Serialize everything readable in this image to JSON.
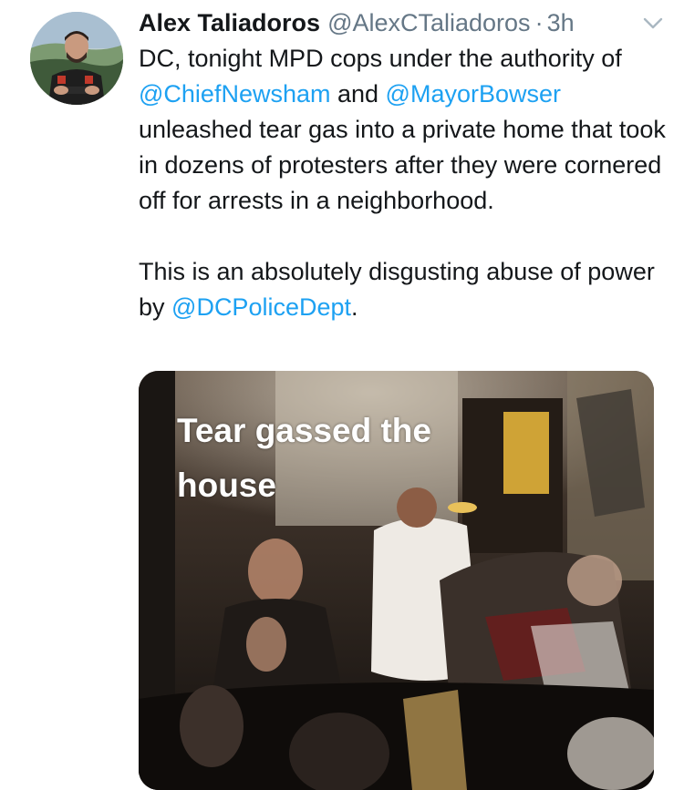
{
  "tweet": {
    "author": {
      "display_name": "Alex Taliadoros",
      "handle": "@AlexCTaliadoros",
      "avatar_icon": "profile-photo"
    },
    "separator": "·",
    "timestamp": "3h",
    "menu_icon": "chevron-down-icon",
    "body": {
      "p1_part1": "DC, tonight MPD cops under the authority of ",
      "mention_1": "@ChiefNewsham",
      "p1_part2": " and ",
      "mention_2": "@MayorBowser",
      "p1_part3": " unleashed tear gas into a private home that took in dozens of protesters after they were cornered off for arrests in a neighborhood.",
      "p2_part1": "This is an absolutely disgusting abuse of power by ",
      "mention_3": "@DCPoliceDept",
      "p2_part2": "."
    },
    "media": {
      "type": "video",
      "caption_overlay": "Tear gassed the\nhouse"
    }
  },
  "colors": {
    "text": "#14171a",
    "secondary_text": "#657786",
    "link": "#1da1f2",
    "background": "#ffffff"
  }
}
